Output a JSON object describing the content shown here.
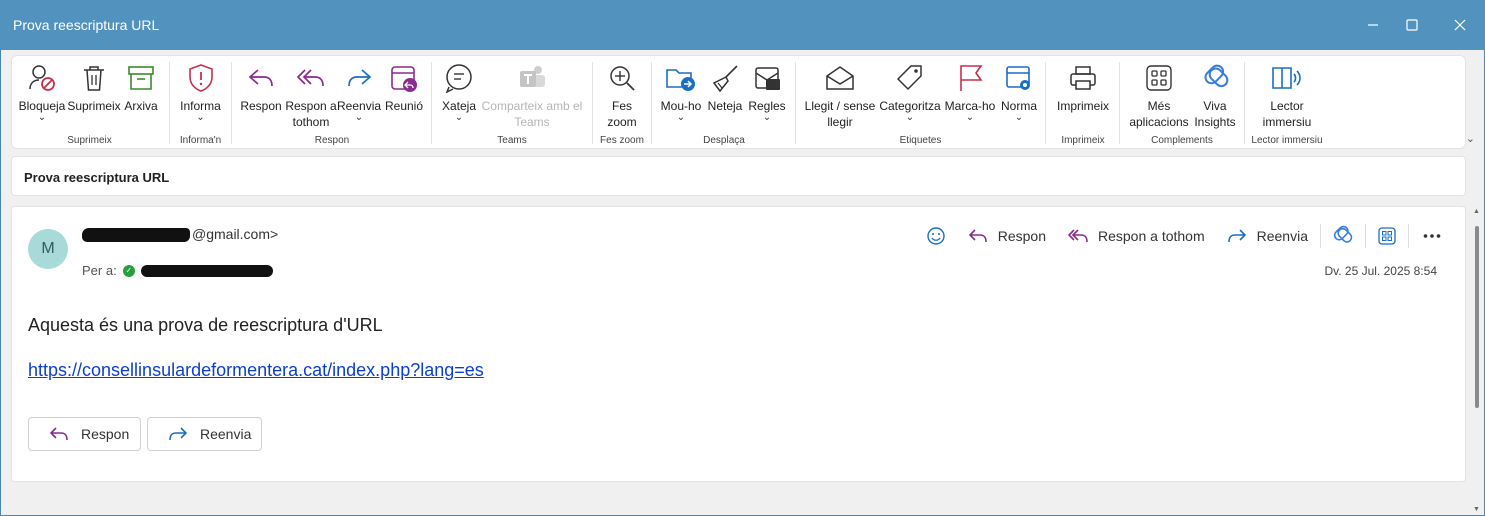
{
  "window": {
    "title": "Prova reescriptura URL",
    "minimize": "minimize",
    "maximize": "maximize",
    "close": "close"
  },
  "ribbon": {
    "groups": [
      {
        "label": "Suprimeix",
        "buttons": [
          "Bloqueja",
          "Suprimeix",
          "Arxiva"
        ]
      },
      {
        "label": "Informa'n",
        "buttons": [
          "Informa"
        ]
      },
      {
        "label": "Respon",
        "buttons": [
          "Respon",
          "Respon a tothom",
          "Reenvia",
          "Reunió"
        ]
      },
      {
        "label": "Teams",
        "buttons": [
          "Xateja",
          "Comparteix amb el Teams"
        ]
      },
      {
        "label": "Fes zoom",
        "buttons": [
          "Fes zoom"
        ]
      },
      {
        "label": "Desplaça",
        "buttons": [
          "Mou-ho",
          "Neteja",
          "Regles"
        ]
      },
      {
        "label": "Etiquetes",
        "buttons": [
          "Llegit / sense llegir",
          "Categoritza",
          "Marca-ho",
          "Norma"
        ]
      },
      {
        "label": "Imprimeix",
        "buttons": [
          "Imprimeix"
        ]
      },
      {
        "label": "Complements",
        "buttons": [
          "Més aplicacions",
          "Viva Insights"
        ]
      },
      {
        "label": "Lector immersiu",
        "buttons": [
          "Lector immersiu"
        ]
      }
    ],
    "labels": {
      "bloqueja": "Bloqueja",
      "suprimeix": "Suprimeix",
      "arxiva": "Arxiva",
      "informa": "Informa",
      "respon": "Respon",
      "respon_tothom_1": "Respon a",
      "respon_tothom_2": "tothom",
      "reenvia": "Reenvia",
      "reunio": "Reunió",
      "xateja": "Xateja",
      "comparteix_1": "Comparteix amb el",
      "comparteix_2": "Teams",
      "zoom_1": "Fes",
      "zoom_2": "zoom",
      "mou": "Mou-ho",
      "neteja": "Neteja",
      "regles": "Regles",
      "llegit_1": "Llegit / sense",
      "llegit_2": "llegir",
      "categoritza": "Categoritza",
      "marca": "Marca-ho",
      "norma": "Norma",
      "imprimeix": "Imprimeix",
      "mes_1": "Més",
      "mes_2": "aplicacions",
      "viva_1": "Viva",
      "viva_2": "Insights",
      "lector_1": "Lector",
      "lector_2": "immersiu"
    },
    "group_labels": {
      "suprimeix": "Suprimeix",
      "informan": "Informa'n",
      "respon": "Respon",
      "teams": "Teams",
      "zoom": "Fes zoom",
      "desplaca": "Desplaça",
      "etiquetes": "Etiquetes",
      "imprimeix": "Imprimeix",
      "complements": "Complements",
      "lector": "Lector immersiu"
    }
  },
  "subject": "Prova reescriptura URL",
  "message": {
    "avatar_initial": "M",
    "from_suffix": "@gmail.com>",
    "to_label": "Per a:",
    "date": "Dv. 25 Jul. 2025 8:54",
    "actions": {
      "respon": "Respon",
      "respon_tothom": "Respon a tothom",
      "reenvia": "Reenvia"
    },
    "body": "Aquesta és una prova de reescriptura d'URL",
    "link": "https://consellinsulardeformentera.cat/index.php?lang=es",
    "bottom_buttons": {
      "respon": "Respon",
      "reenvia": "Reenvia"
    }
  },
  "colors": {
    "titlebar": "#5292be",
    "accent_purple": "#8b2a8f",
    "accent_blue": "#1a6fc4",
    "link": "#0b3fd0",
    "avatar_bg": "#a8dad9"
  }
}
